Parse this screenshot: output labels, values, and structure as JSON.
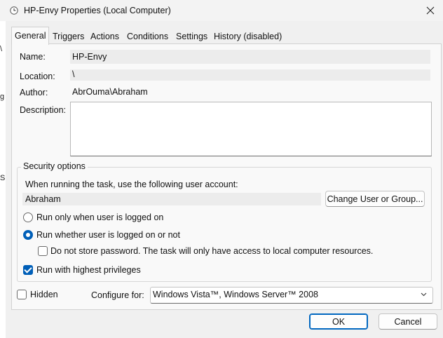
{
  "window": {
    "title": "HP-Envy Properties (Local Computer)"
  },
  "tabs": [
    {
      "label": "General",
      "active": true
    },
    {
      "label": "Triggers"
    },
    {
      "label": "Actions"
    },
    {
      "label": "Conditions"
    },
    {
      "label": "Settings"
    },
    {
      "label": "History (disabled)"
    }
  ],
  "general": {
    "name_label": "Name:",
    "name_value": "HP-Envy",
    "location_label": "Location:",
    "location_value": "\\",
    "author_label": "Author:",
    "author_value": "AbrOuma\\Abraham",
    "description_label": "Description:",
    "description_value": ""
  },
  "security": {
    "group_title": "Security options",
    "account_prompt": "When running the task, use the following user account:",
    "account_value": "Abraham",
    "change_button": "Change User or Group...",
    "radio_logged_on": "Run only when user is logged on",
    "radio_whether": "Run whether user is logged on or not",
    "selected_radio": "radio_whether",
    "no_store_password": "Do not store password.  The task will only have access to local computer resources.",
    "no_store_password_checked": false,
    "highest_privileges": "Run with highest privileges",
    "highest_privileges_checked": true
  },
  "footer": {
    "hidden_label": "Hidden",
    "hidden_checked": false,
    "configure_label": "Configure for:",
    "configure_value": "Windows Vista™, Windows Server™ 2008",
    "ok_button": "OK",
    "cancel_button": "Cancel"
  },
  "background": {
    "edge_glyphs": [
      "\\",
      "g",
      "S"
    ]
  },
  "colors": {
    "accent": "#005fb8",
    "primary_border": "#0067c0"
  }
}
